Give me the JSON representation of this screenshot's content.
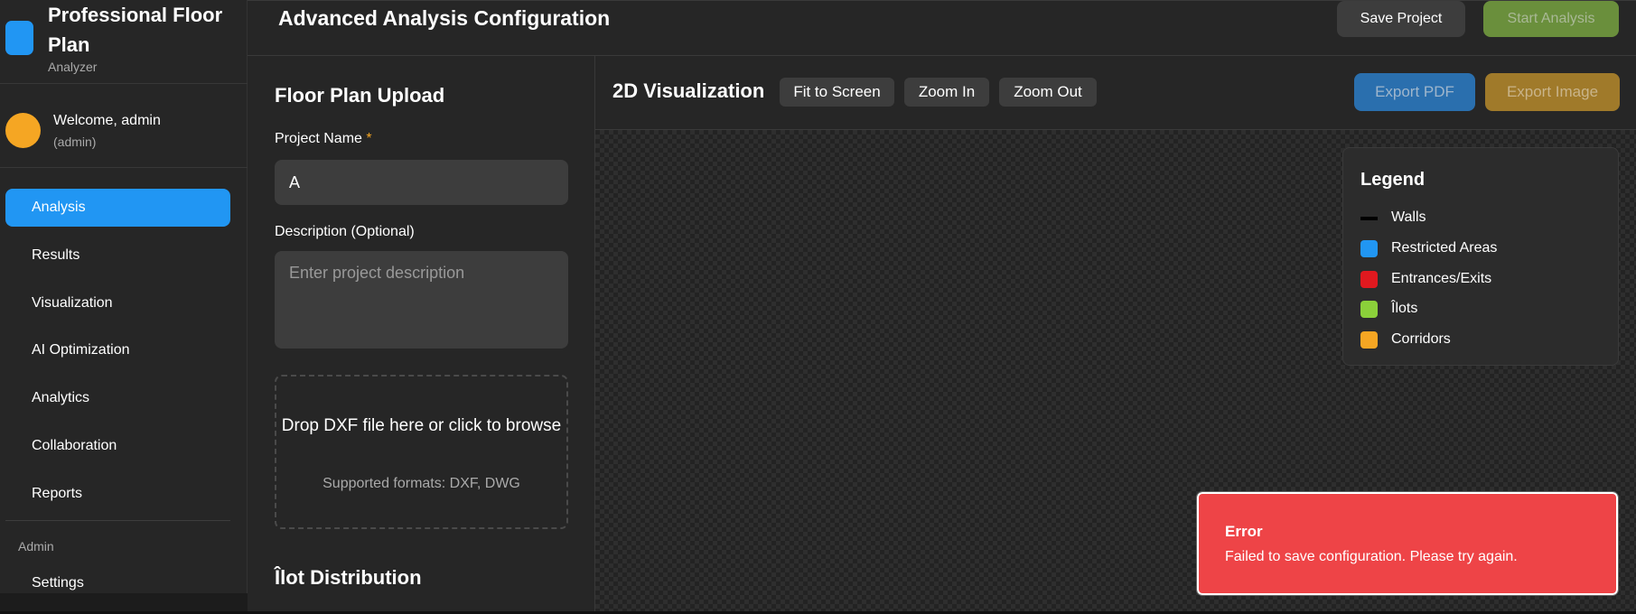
{
  "brand": {
    "title": "Professional Floor Plan",
    "subtitle": "Analyzer"
  },
  "user": {
    "welcome": "Welcome, admin",
    "role": "(admin)"
  },
  "sidebar": {
    "items": [
      {
        "label": "Analysis",
        "active": true
      },
      {
        "label": "Results"
      },
      {
        "label": "Visualization"
      },
      {
        "label": "AI Optimization"
      },
      {
        "label": "Analytics"
      },
      {
        "label": "Collaboration"
      },
      {
        "label": "Reports"
      }
    ],
    "admin_section": "Admin",
    "admin_items": [
      {
        "label": "Settings"
      }
    ]
  },
  "header": {
    "title": "Advanced Analysis Configuration",
    "save_label": "Save Project",
    "start_label": "Start Analysis"
  },
  "upload": {
    "title": "Floor Plan Upload",
    "project_name_label": "Project Name",
    "required_marker": "*",
    "project_name_value": "A",
    "description_label": "Description (Optional)",
    "description_placeholder": "Enter project description",
    "drop_text": "Drop DXF file here or click to browse",
    "supported_formats": "Supported formats: DXF, DWG",
    "ilot_title": "Îlot Distribution"
  },
  "visualization": {
    "title": "2D Visualization",
    "fit_label": "Fit to Screen",
    "zoom_in_label": "Zoom In",
    "zoom_out_label": "Zoom Out",
    "export_pdf_label": "Export PDF",
    "export_image_label": "Export Image"
  },
  "legend": {
    "title": "Legend",
    "items": [
      {
        "label": "Walls",
        "color": "#000000",
        "shape": "line"
      },
      {
        "label": "Restricted Areas",
        "color": "#2196f3",
        "shape": "square"
      },
      {
        "label": "Entrances/Exits",
        "color": "#e0191f",
        "shape": "square"
      },
      {
        "label": "Îlots",
        "color": "#8bd13a",
        "shape": "square"
      },
      {
        "label": "Corridors",
        "color": "#f5a623",
        "shape": "square"
      }
    ]
  },
  "toast": {
    "title": "Error",
    "message": "Failed to save configuration. Please try again."
  },
  "colors": {
    "accent": "#2196f3",
    "error": "#ee4447",
    "start_button": "#6a8f3c",
    "export_pdf": "#2a6fae",
    "export_image": "#a07a2a"
  }
}
